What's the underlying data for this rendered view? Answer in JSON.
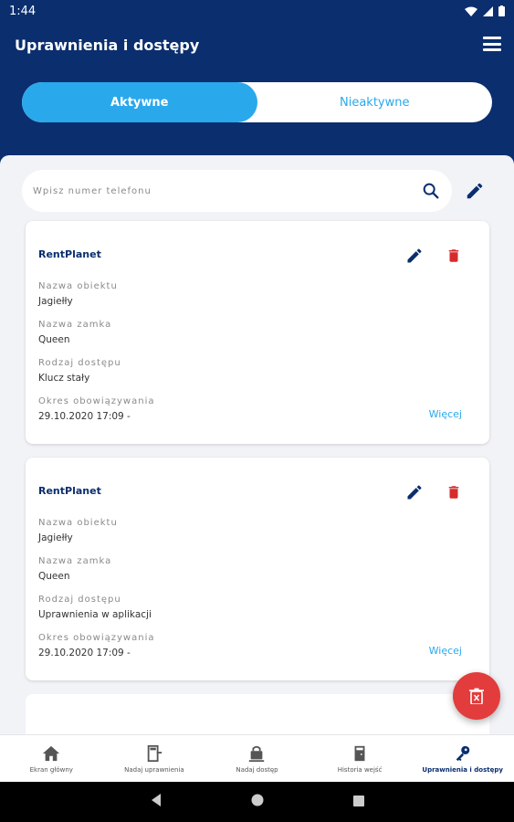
{
  "status": {
    "time": "1:44"
  },
  "header": {
    "title": "Uprawnienia i dostępy"
  },
  "toggle": {
    "active": "Aktywne",
    "inactive": "Nieaktywne"
  },
  "search": {
    "placeholder": "Wpisz numer telefonu"
  },
  "cards": [
    {
      "title": "RentPlanet",
      "object_label": "Nazwa obiektu",
      "object_value": "Jagiełły",
      "lock_label": "Nazwa zamka",
      "lock_value": "Queen",
      "access_label": "Rodzaj dostępu",
      "access_value": "Klucz stały",
      "period_label": "Okres obowiązywania",
      "period_value": "29.10.2020 17:09 -",
      "more": "Więcej"
    },
    {
      "title": "RentPlanet",
      "object_label": "Nazwa obiektu",
      "object_value": "Jagiełły",
      "lock_label": "Nazwa zamka",
      "lock_value": "Queen",
      "access_label": "Rodzaj dostępu",
      "access_value": "Uprawnienia w aplikacji",
      "period_label": "Okres obowiązywania",
      "period_value": "29.10.2020 17:09 -",
      "more": "Więcej"
    }
  ],
  "bottom_nav": [
    {
      "label": "Ekran główny",
      "icon": "home-icon"
    },
    {
      "label": "Nadaj uprawnienia",
      "icon": "door-icon"
    },
    {
      "label": "Nadaj dostęp",
      "icon": "lock-keypad-icon"
    },
    {
      "label": "Historia wejść",
      "icon": "history-icon"
    },
    {
      "label": "Uprawnienia i dostępy",
      "icon": "key-icon",
      "active": true
    }
  ],
  "colors": {
    "primary": "#0a2e6e",
    "accent": "#2aa8ec",
    "danger": "#e23c3c",
    "background": "#f2f3f7"
  }
}
